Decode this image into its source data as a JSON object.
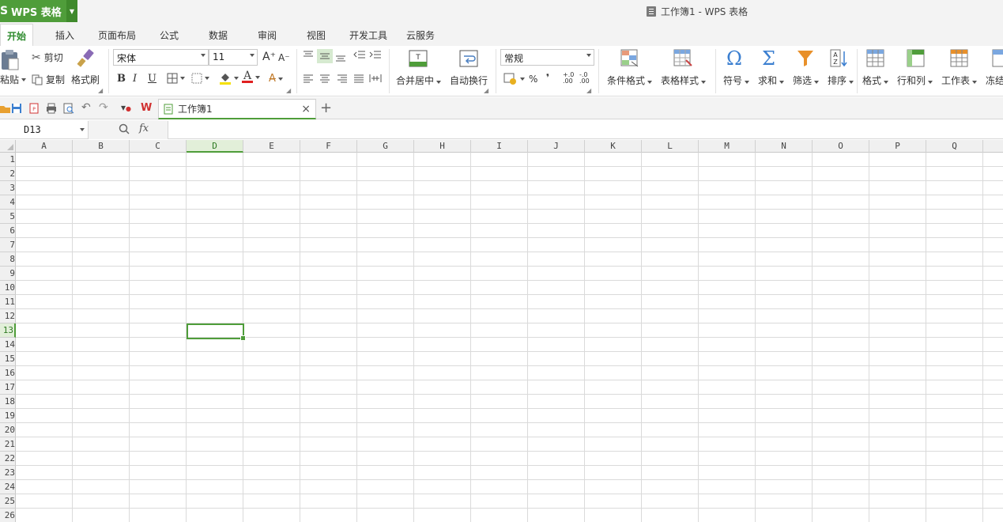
{
  "app": {
    "name": "WPS 表格",
    "logo_char": "S",
    "window_title": "工作簿1 - WPS 表格"
  },
  "menu": {
    "tabs": [
      {
        "label": "开始",
        "active": true
      },
      {
        "label": "插入"
      },
      {
        "label": "页面布局"
      },
      {
        "label": "公式"
      },
      {
        "label": "数据"
      },
      {
        "label": "审阅"
      },
      {
        "label": "视图"
      },
      {
        "label": "开发工具"
      },
      {
        "label": "云服务"
      }
    ]
  },
  "ribbon": {
    "paste_label": "粘贴",
    "cut_label": "剪切",
    "copy_label": "复制",
    "format_painter_label": "格式刷",
    "font_name": "宋体",
    "font_size": "11",
    "bold": "B",
    "italic": "I",
    "underline": "U",
    "font_color_glyph": "A",
    "grow_font": "A⁺",
    "shrink_font": "A⁻",
    "merge_center_label": "合并居中",
    "wrap_text_label": "自动换行",
    "number_format": "常规",
    "percent": "%",
    "comma": "❜",
    "inc_decimal": "+.0 .00",
    "dec_decimal": "-.0 .00",
    "conditional_format_label": "条件格式",
    "table_style_label": "表格样式",
    "symbol_label": "符号",
    "sum_label": "求和",
    "filter_label": "筛选",
    "sort_label": "排序",
    "format_label": "格式",
    "row_col_label": "行和列",
    "worksheet_label": "工作表",
    "freeze_label": "冻结"
  },
  "doc_tabs": [
    {
      "title": "工作簿1",
      "close": "×"
    }
  ],
  "new_tab": "+",
  "formula_bar": {
    "name_box": "D13",
    "fx": "fx",
    "formula": ""
  },
  "sheet": {
    "columns": [
      "A",
      "B",
      "C",
      "D",
      "E",
      "F",
      "G",
      "H",
      "I",
      "J",
      "K",
      "L",
      "M",
      "N",
      "O",
      "P",
      "Q"
    ],
    "rows": [
      "1",
      "2",
      "3",
      "4",
      "5",
      "6",
      "7",
      "8",
      "9",
      "10",
      "11",
      "12",
      "13",
      "14",
      "15",
      "16",
      "17",
      "18",
      "19",
      "20",
      "21",
      "22",
      "23",
      "24",
      "25",
      "26"
    ],
    "selected_col": "D",
    "selected_row": "13"
  },
  "colors": {
    "accent": "#4f9d3a",
    "title_bg": "#f3f3f3",
    "grid_line": "#dadada"
  }
}
